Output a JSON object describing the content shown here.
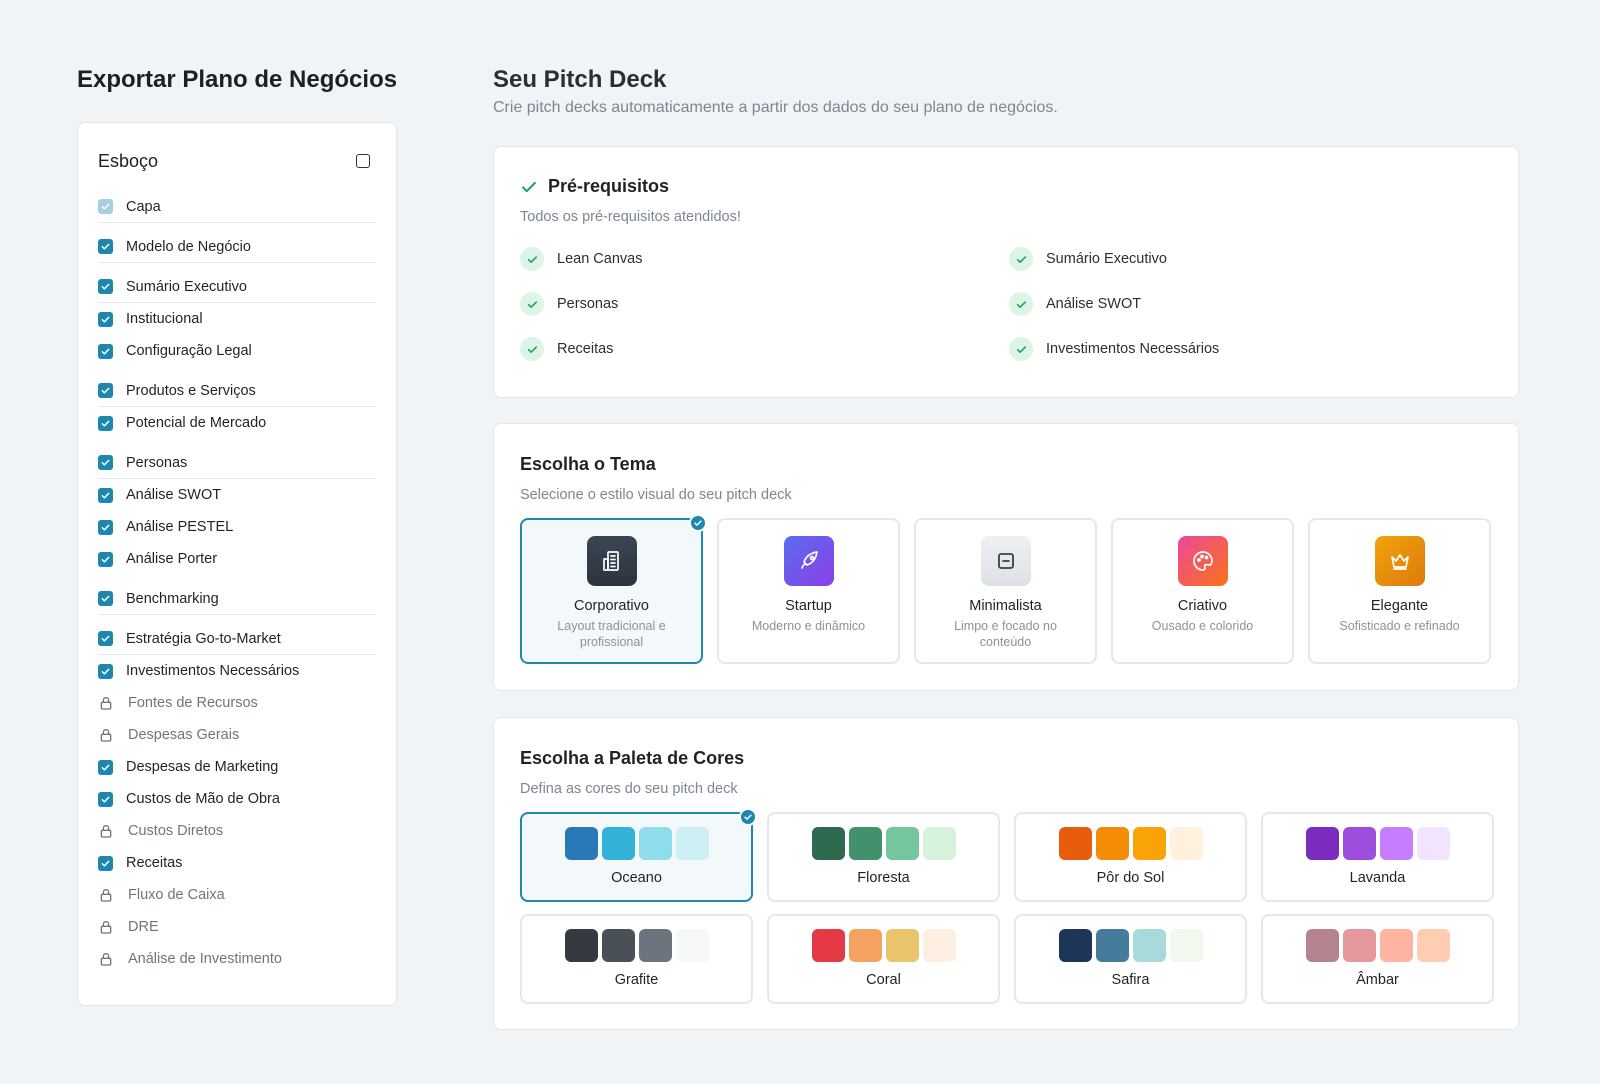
{
  "left": {
    "title": "Exportar Plano de Negócios",
    "outline_title": "Esboço",
    "items": [
      {
        "label": "Capa",
        "state": "faded",
        "divider": true
      },
      {
        "label": "Modelo de Negócio",
        "state": "checked",
        "divider": true
      },
      {
        "label": "Sumário Executivo",
        "state": "checked",
        "divider": true
      },
      {
        "label": "Institucional",
        "state": "checked",
        "divider": false
      },
      {
        "label": "Configuração Legal",
        "state": "checked",
        "divider": false
      },
      {
        "label": "Produtos e Serviços",
        "state": "checked",
        "divider": true
      },
      {
        "label": "Potencial de Mercado",
        "state": "checked",
        "divider": false
      },
      {
        "label": "Personas",
        "state": "checked",
        "divider": true
      },
      {
        "label": "Análise SWOT",
        "state": "checked",
        "divider": false
      },
      {
        "label": "Análise PESTEL",
        "state": "checked",
        "divider": false
      },
      {
        "label": "Análise Porter",
        "state": "checked",
        "divider": false
      },
      {
        "label": "Benchmarking",
        "state": "checked",
        "divider": true
      },
      {
        "label": "Estratégia Go-to-Market",
        "state": "checked",
        "divider": true
      },
      {
        "label": "Investimentos Necessários",
        "state": "checked",
        "divider": false
      },
      {
        "label": "Fontes de Recursos",
        "state": "locked",
        "divider": false
      },
      {
        "label": "Despesas Gerais",
        "state": "locked",
        "divider": false
      },
      {
        "label": "Despesas de Marketing",
        "state": "checked",
        "divider": false
      },
      {
        "label": "Custos de Mão de Obra",
        "state": "checked",
        "divider": false
      },
      {
        "label": "Custos Diretos",
        "state": "locked",
        "divider": false
      },
      {
        "label": "Receitas",
        "state": "checked",
        "divider": false
      },
      {
        "label": "Fluxo de Caixa",
        "state": "locked",
        "divider": false
      },
      {
        "label": "DRE",
        "state": "locked",
        "divider": false
      },
      {
        "label": "Análise de Investimento",
        "state": "locked",
        "divider": false
      }
    ]
  },
  "main": {
    "title": "Seu Pitch Deck",
    "subtitle": "Crie pitch decks automaticamente a partir dos dados do seu plano de negócios.",
    "prereq": {
      "title": "Pré-requisitos",
      "subtitle": "Todos os pré-requisitos atendidos!",
      "items": [
        "Lean Canvas",
        "Sumário Executivo",
        "Personas",
        "Análise SWOT",
        "Receitas",
        "Investimentos Necessários"
      ]
    },
    "theme": {
      "title": "Escolha o Tema",
      "subtitle": "Selecione o estilo visual do seu pitch deck",
      "options": [
        {
          "name": "Corporativo",
          "desc": "Layout tradicional e profissional",
          "icon": "building-icon",
          "selected": true
        },
        {
          "name": "Startup",
          "desc": "Moderno e dinâmico",
          "icon": "rocket-icon",
          "selected": false
        },
        {
          "name": "Minimalista",
          "desc": "Limpo e focado no conteúdo",
          "icon": "minus-square-icon",
          "selected": false
        },
        {
          "name": "Criativo",
          "desc": "Ousado e colorido",
          "icon": "palette-icon",
          "selected": false
        },
        {
          "name": "Elegante",
          "desc": "Sofisticado e refinado",
          "icon": "crown-icon",
          "selected": false
        }
      ]
    },
    "palette": {
      "title": "Escolha a Paleta de Cores",
      "subtitle": "Defina as cores do seu pitch deck",
      "options": [
        {
          "name": "Oceano",
          "colors": [
            "#2979b9",
            "#33b1d6",
            "#8fdcec",
            "#cdeff5"
          ],
          "selected": true
        },
        {
          "name": "Floresta",
          "colors": [
            "#2d6a4f",
            "#40916c",
            "#74c69d",
            "#d8f3dc"
          ],
          "selected": false
        },
        {
          "name": "Pôr do Sol",
          "colors": [
            "#e85d0c",
            "#f48c06",
            "#faa307",
            "#fff1dd"
          ],
          "selected": false
        },
        {
          "name": "Lavanda",
          "colors": [
            "#7b2cbf",
            "#9d4edd",
            "#c77dff",
            "#f1e4fc"
          ],
          "selected": false
        },
        {
          "name": "Grafite",
          "colors": [
            "#343a40",
            "#495057",
            "#6c757d",
            "#f6f7f8"
          ],
          "selected": false
        },
        {
          "name": "Coral",
          "colors": [
            "#e63946",
            "#f4a261",
            "#e9c46a",
            "#fdf0e3"
          ],
          "selected": false
        },
        {
          "name": "Safira",
          "colors": [
            "#1d3557",
            "#457b9d",
            "#a8dadc",
            "#f1f8ee"
          ],
          "selected": false
        },
        {
          "name": "Âmbar",
          "colors": [
            "#b5838d",
            "#e5989b",
            "#ffb4a2",
            "#ffcdb2"
          ],
          "selected": false
        }
      ]
    }
  },
  "colors": {
    "accent": "#1e87ad",
    "success": "#22a35a",
    "background": "#f1f4f6"
  }
}
